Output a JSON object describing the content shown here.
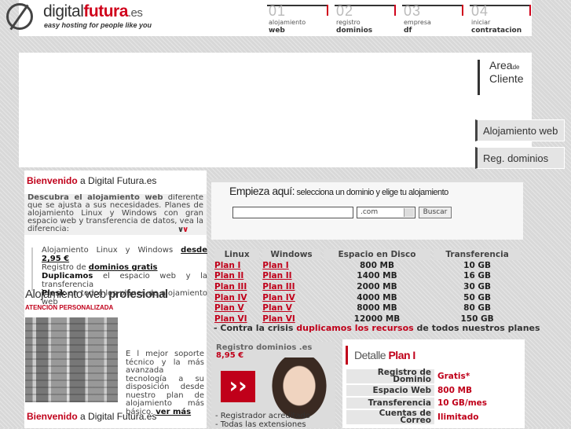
{
  "header": {
    "logo": {
      "prefix": "digital",
      "brand": "futura",
      "tld": ".es",
      "tagline": "easy hosting for people like you"
    },
    "nav": [
      {
        "num": "01",
        "line1": "alojamiento",
        "line2": "web"
      },
      {
        "num": "02",
        "line1": "registro",
        "line2": "dominios"
      },
      {
        "num": "03",
        "line1": "empresa",
        "line2": "df"
      },
      {
        "num": "04",
        "line1": "iniciar",
        "line2": "contratacion"
      }
    ]
  },
  "side_menu": {
    "area_cliente": {
      "line1": "Area",
      "small": "de",
      "line2": "Cliente"
    },
    "buttons": [
      "Alojamiento web",
      "Reg. dominios"
    ]
  },
  "welcome": {
    "prefix": "Bienvenido",
    "rest": " a Digital Futura.es"
  },
  "intro": {
    "bold": "Descubra el alojamiento web",
    "text": " diferente que se ajusta a sus necesidades. Planes de alojamiento Linux y Windows con gran espacio web y transferencia de datos, vea la diferencia:"
  },
  "features": [
    {
      "text": "Alojamiento Linux y Windows ",
      "link": "desde 2,95 €"
    },
    {
      "text": "Registro de ",
      "link": "dominios gratis"
    },
    {
      "bold": "Duplicamos",
      "text": " el espacio web y la transferencia"
    },
    {
      "bold": "Plesk",
      "text": " en todos los planes de alojamiento web"
    }
  ],
  "professional": {
    "prefix": "Alojamiento web ",
    "bold": "profesional",
    "sub": "ATENCION PERSONALIZADA"
  },
  "support": {
    "text": "E l mejor soporte técnico y la más avanzada tecnología a su disposición desde nuestro plan de alojamiento más básico. ",
    "link": "ver más"
  },
  "search": {
    "title": "Empieza aquí:",
    "subtitle": " selecciona un dominio y elige tu alojamiento",
    "input_value": "",
    "tld": ".com",
    "button": "Buscar"
  },
  "plans": {
    "headers": [
      "Linux",
      "Windows",
      "Espacio en Disco",
      "Transferencia"
    ],
    "rows": [
      [
        "Plan I",
        "Plan I",
        "800 MB",
        "10 GB"
      ],
      [
        "Plan II",
        "Plan II",
        "1400 MB",
        "16 GB"
      ],
      [
        "Plan III",
        "Plan III",
        "2000 MB",
        "30 GB"
      ],
      [
        "Plan IV",
        "Plan IV",
        "4000 MB",
        "50 GB"
      ],
      [
        "Plan V",
        "Plan V",
        "8000 MB",
        "80 GB"
      ],
      [
        "Plan VI",
        "Plan VI",
        "12000 MB",
        "150 GB"
      ]
    ],
    "crisis": {
      "prefix": "- Contra la crisis ",
      "highlight": "duplicamos los recursos",
      "suffix": " de todos nuestros planes"
    }
  },
  "promo": {
    "title": "Registro dominios .es",
    "price": "8,95 €",
    "line1": "- Registrador acreditado",
    "line2": "- Todas las extensiones"
  },
  "detail": {
    "title_prefix": "Detalle ",
    "title_plan": "Plan I",
    "rows": [
      {
        "label": "Registro de Dominio",
        "value": "Gratis*"
      },
      {
        "label": "Espacio Web",
        "value": "800 MB"
      },
      {
        "label": "Transferencia",
        "value": "10 GB/mes"
      },
      {
        "label": "Cuentas de Correo",
        "value": "Ilimitado"
      }
    ]
  },
  "colors": {
    "accent": "#c0001a",
    "dark": "#333333",
    "panel": "#ffffff",
    "background": "#d8d8d8"
  }
}
